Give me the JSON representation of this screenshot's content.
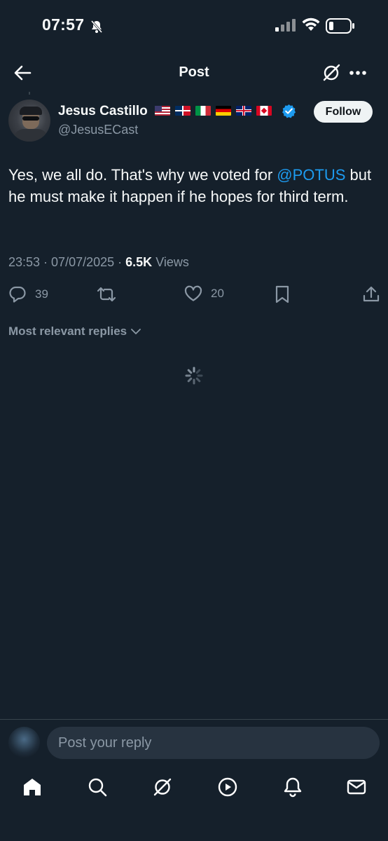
{
  "status_bar": {
    "time": "07:57"
  },
  "header": {
    "title": "Post"
  },
  "post": {
    "author_name": "Jesus Castillo",
    "handle": "@JesusECast",
    "follow_label": "Follow",
    "text_before_mention": "Yes, we all do. That's why we voted for ",
    "mention": "@POTUS",
    "text_after_mention": " but he must make it happen if he hopes for third term.",
    "time": "23:53",
    "date": "07/07/2025",
    "views_count": "6.5K",
    "views_label": "Views",
    "replies": "39",
    "likes": "20"
  },
  "replies_filter": {
    "label": "Most relevant replies"
  },
  "composer": {
    "placeholder": "Post your reply"
  },
  "icons": {
    "back": "arrow-left-icon",
    "grok": "grok-icon",
    "more": "more-icon",
    "reply": "reply-icon",
    "repost": "repost-icon",
    "like": "heart-icon",
    "bookmark": "bookmark-icon",
    "share": "share-icon",
    "tabs": [
      "home-icon",
      "search-icon",
      "grok-icon",
      "play-icon",
      "bell-icon",
      "mail-icon"
    ]
  },
  "colors": {
    "background": "#15202b",
    "accent": "#1d9bf0",
    "muted": "#8b98a5",
    "verified": "#1d9bf0"
  }
}
